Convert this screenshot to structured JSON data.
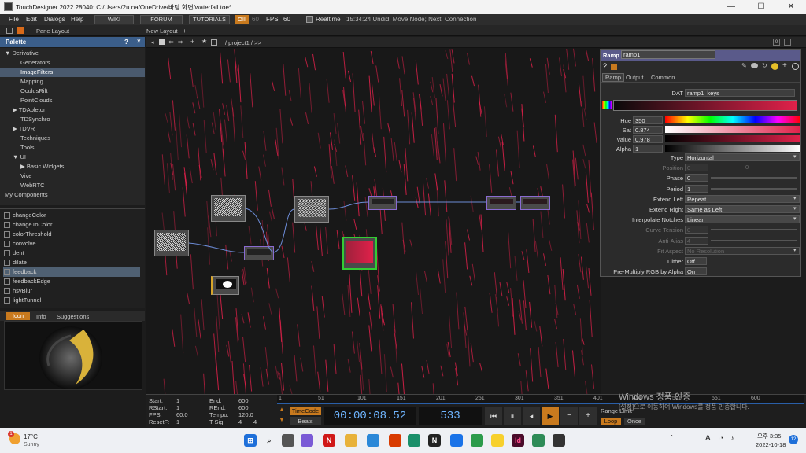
{
  "window": {
    "title": "TouchDesigner 2022.28040: C:/Users/2u.na/OneDrive/바탕 화면/waterfall.toe*",
    "controls": [
      "—",
      "☐",
      "✕"
    ]
  },
  "menubar": {
    "items": [
      "File",
      "Edit",
      "Dialogs",
      "Help"
    ],
    "wiki": "WIKI",
    "forum": "FORUM",
    "tutorials": "TUTORIALS",
    "oii": "OII",
    "fps_dim": "60",
    "fps_label": "FPS:",
    "fps_value": "60",
    "realtime": "Realtime",
    "status": "15:34:24 Undid: Move Node; Next: Connection"
  },
  "toolbar2": {
    "pane_layout": "Pane Layout",
    "new_layout": "New Layout"
  },
  "palette": {
    "title": "Palette",
    "help": "?",
    "close": "×",
    "tree": [
      {
        "label": "Derivative",
        "indent": 0,
        "arrow": "▼"
      },
      {
        "label": "Generators",
        "indent": 2,
        "arrow": ""
      },
      {
        "label": "ImageFilters",
        "indent": 2,
        "arrow": "",
        "selected": true
      },
      {
        "label": "Mapping",
        "indent": 2,
        "arrow": ""
      },
      {
        "label": "OculusRift",
        "indent": 2,
        "arrow": ""
      },
      {
        "label": "PointClouds",
        "indent": 2,
        "arrow": ""
      },
      {
        "label": "TDAbleton",
        "indent": 1,
        "arrow": "▶"
      },
      {
        "label": "TDSynchro",
        "indent": 2,
        "arrow": ""
      },
      {
        "label": "TDVR",
        "indent": 1,
        "arrow": "▶"
      },
      {
        "label": "Techniques",
        "indent": 2,
        "arrow": ""
      },
      {
        "label": "Tools",
        "indent": 2,
        "arrow": ""
      },
      {
        "label": "UI",
        "indent": 1,
        "arrow": "▼"
      },
      {
        "label": "Basic Widgets",
        "indent": 2,
        "arrow": "▶"
      },
      {
        "label": "Vive",
        "indent": 2,
        "arrow": ""
      },
      {
        "label": "WebRTC",
        "indent": 2,
        "arrow": ""
      },
      {
        "label": "My Components",
        "indent": 0,
        "arrow": ""
      }
    ],
    "ops": [
      "changeColor",
      "changeToColor",
      "colorThreshold",
      "convolve",
      "dent",
      "dilate",
      "feedback",
      "feedbackEdge",
      "hsvBlur",
      "lightTunnel"
    ],
    "selected_op": "feedback",
    "preview_tabs": [
      "Icon",
      "Info",
      "Suggestions"
    ]
  },
  "network": {
    "path": "/ project1 / >>",
    "right_zero": "0"
  },
  "params": {
    "op_type": "Ramp",
    "op_name": "ramp1",
    "tabs": [
      "Ramp",
      "Output",
      "Common"
    ],
    "dat_label": "DAT",
    "dat_value": "ramp1_keys",
    "hue_label": "Hue",
    "hue_value": "350",
    "sat_label": "Sat",
    "sat_value": "0.874",
    "value_label": "Value",
    "value_value": "0.978",
    "alpha_label": "Alpha",
    "alpha_value": "1",
    "rows": [
      {
        "label": "Type",
        "value": "Horizontal",
        "kind": "menu",
        "dim": false
      },
      {
        "label": "Position",
        "value": "0",
        "value2": "0",
        "kind": "dual",
        "dim": true
      },
      {
        "label": "Phase",
        "value": "0",
        "kind": "slider",
        "dim": false
      },
      {
        "label": "Period",
        "value": "1",
        "kind": "slider",
        "dim": false
      },
      {
        "label": "Extend Left",
        "value": "Repeat",
        "kind": "menu",
        "dim": false
      },
      {
        "label": "Extend Right",
        "value": "Same as Left",
        "kind": "menu",
        "dim": false
      },
      {
        "label": "Interpolate Notches",
        "value": "Linear",
        "kind": "menu",
        "dim": false
      },
      {
        "label": "Curve Tension",
        "value": "0",
        "kind": "slider",
        "dim": true
      },
      {
        "label": "Anti-Alias",
        "value": "4",
        "kind": "slider",
        "dim": true
      },
      {
        "label": "Fit Aspect",
        "value": "No Resolution",
        "kind": "menu",
        "dim": true
      },
      {
        "label": "Dither",
        "value": "Off",
        "kind": "toggle",
        "dim": false
      },
      {
        "label": "Pre-Multiply RGB by Alpha",
        "value": "On",
        "kind": "toggle",
        "dim": false
      }
    ]
  },
  "timeline": {
    "start_label": "Start:",
    "start": "1",
    "rstart_label": "RStart:",
    "rstart": "1",
    "fps_label": "FPS:",
    "fps": "60.0",
    "resetf_label": "ResetF:",
    "resetf": "1",
    "end_label": "End:",
    "end": "600",
    "rend_label": "REnd:",
    "rend": "600",
    "tempo_label": "Tempo:",
    "tempo": "120.0",
    "tsig_label": "T Sig:",
    "tsig_a": "4",
    "tsig_b": "4",
    "ruler": [
      "1",
      "51",
      "101",
      "151",
      "201",
      "251",
      "301",
      "351",
      "401",
      "451",
      "501",
      "551",
      "600"
    ],
    "timecode_btn": "TimeCode",
    "beats_btn": "Beats",
    "timecode": "00:00:08.52",
    "frame": "533",
    "range_limit": "Range Limit",
    "loop": "Loop",
    "once": "Once",
    "watermark1": "Windows 정품 인증",
    "watermark2": "[설정]으로 이동하여 Windows를 정품 인증합니다."
  },
  "taskbar": {
    "temp": "17°C",
    "weather": "Sunny",
    "badge": "1",
    "ime": "A",
    "time": "오후 3:35",
    "date": "2022-10-18",
    "notif": "12"
  },
  "colors": {
    "accent": "#e0214a",
    "palette_head": "#3b5e8a",
    "node_select": "#3c3"
  }
}
